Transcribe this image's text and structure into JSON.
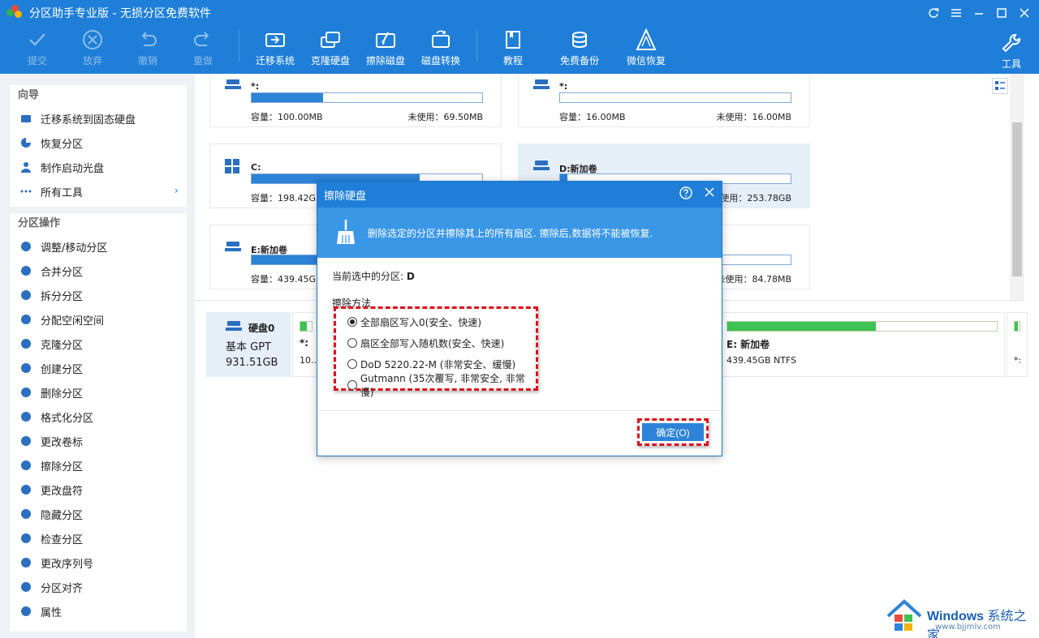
{
  "window": {
    "title": "分区助手专业版 - 无损分区免费软件",
    "buttons": [
      "refresh",
      "menu",
      "minimize",
      "maximize",
      "close"
    ]
  },
  "toolbar": {
    "items": [
      {
        "label": "提交",
        "icon": "check-icon",
        "enabled": false
      },
      {
        "label": "放弃",
        "icon": "cancel-icon",
        "enabled": false
      },
      {
        "label": "撤销",
        "icon": "undo-icon",
        "enabled": false
      },
      {
        "label": "重做",
        "icon": "redo-icon",
        "enabled": false
      },
      {
        "label": "迁移系统",
        "icon": "migrate-icon",
        "enabled": true
      },
      {
        "label": "克隆硬盘",
        "icon": "clone-disk-icon",
        "enabled": true
      },
      {
        "label": "擦除磁盘",
        "icon": "wipe-disk-icon",
        "enabled": true
      },
      {
        "label": "磁盘转换",
        "icon": "convert-icon",
        "enabled": true
      },
      {
        "label": "教程",
        "icon": "book-icon",
        "enabled": true
      },
      {
        "label": "免费备份",
        "icon": "backup-icon",
        "enabled": true
      },
      {
        "label": "微信恢复",
        "icon": "recover-icon",
        "enabled": true
      }
    ],
    "tools_label": "工具"
  },
  "sidebar": {
    "wizard_title": "向导",
    "wizard_items": [
      "迁移系统到固态硬盘",
      "恢复分区",
      "制作启动光盘",
      "所有工具"
    ],
    "ops_title": "分区操作",
    "ops_items": [
      "调整/移动分区",
      "合并分区",
      "拆分分区",
      "分配空闲空间",
      "克隆分区",
      "创建分区",
      "删除分区",
      "格式化分区",
      "更改卷标",
      "擦除分区",
      "更改盘符",
      "隐藏分区",
      "检查分区",
      "更改序列号",
      "分区对齐",
      "属性"
    ]
  },
  "cards": [
    {
      "name": "*:",
      "cap": "容量：100.00MB",
      "free": "未使用：69.50MB",
      "fill": 0.31
    },
    {
      "name": "*:",
      "cap": "容量：16.00MB",
      "free": "未使用：16.00MB",
      "fill": 0
    },
    {
      "name": "C:",
      "cap": "容量：198.42GB",
      "free": "",
      "fill": 0.73
    },
    {
      "name": "D:新加卷",
      "cap": "",
      "free": "未使用：253.78GB",
      "fill": 0.03
    },
    {
      "name": "E:新加卷",
      "cap": "容量：439.45GB",
      "free": "",
      "fill": 0.28
    },
    {
      "name": "",
      "cap": "",
      "free": "未使用：84.78MB",
      "fill": 0.5
    }
  ],
  "disk": {
    "name": "硬盘0",
    "type": "基本 GPT",
    "size": "931.51GB",
    "parts": [
      {
        "name": "*:",
        "size": "10..."
      },
      {
        "name": "E: 新加卷",
        "size": "439.45GB NTFS",
        "fill": 0.55
      },
      {
        "name": "",
        "size": "*:"
      }
    ]
  },
  "dialog": {
    "title": "擦除硬盘",
    "banner": "删除选定的分区并擦除其上的所有扇区. 擦除后,数据将不能被恢复.",
    "current_label": "当前选中的分区:",
    "current_value": "D",
    "method_label": "擦除方法",
    "options": [
      {
        "label": "全部扇区写入0(安全、快速)",
        "selected": true
      },
      {
        "label": "扇区全部写入随机数(安全、快速)",
        "selected": false
      },
      {
        "label": "DoD 5220.22-M (非常安全、缓慢)",
        "selected": false
      },
      {
        "label": "Gutmann (35次覆写, 非常安全, 非常慢)",
        "selected": false
      }
    ],
    "ok_label": "确定(O)"
  },
  "watermark": {
    "brand": "Windows",
    "suffix": "系统之家",
    "url": "www.bjjmlv.com"
  },
  "colors": {
    "accent": "#1f7fd8",
    "bar": "#2d83d8",
    "green": "#3fc254",
    "highlight": "#d9111c"
  }
}
